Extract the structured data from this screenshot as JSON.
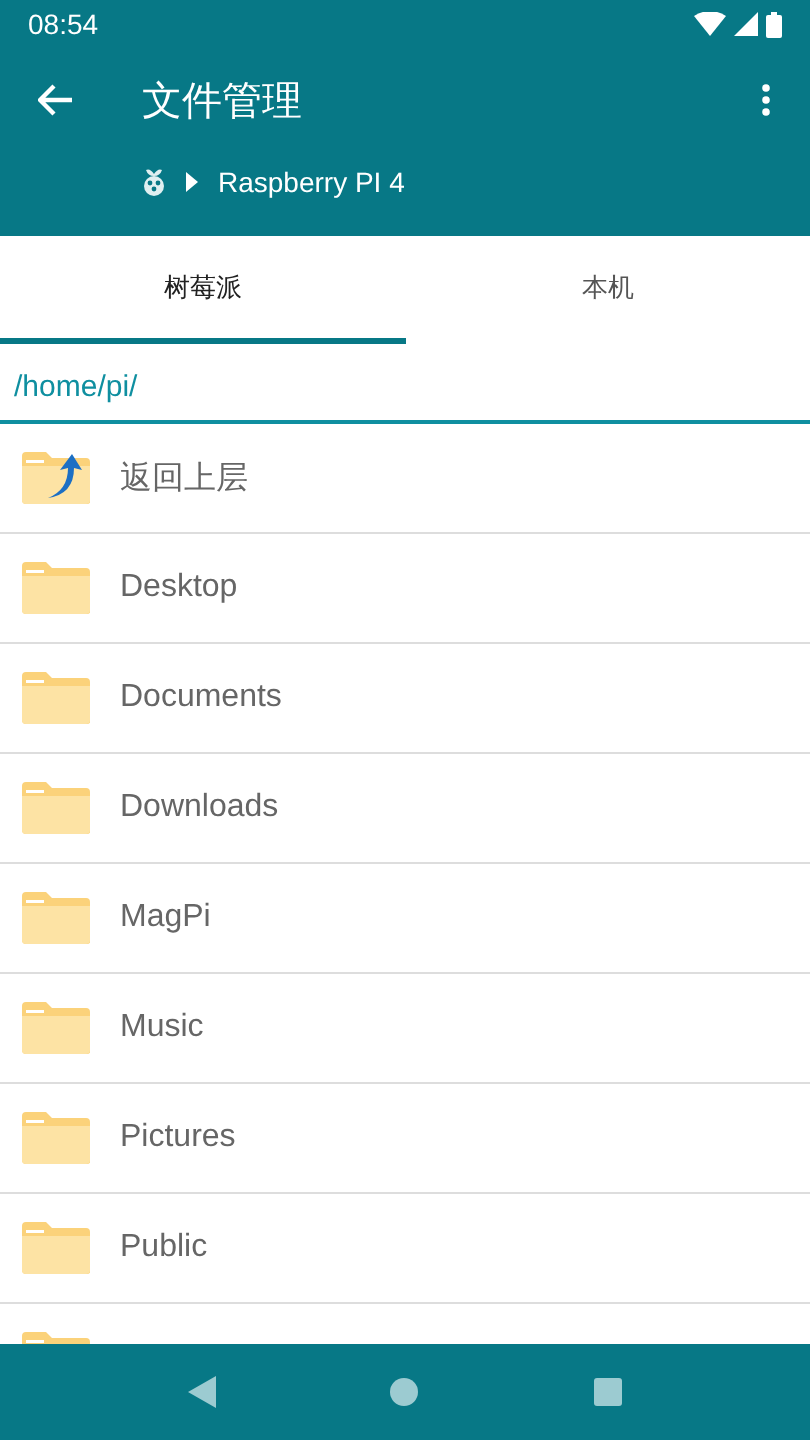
{
  "status_bar": {
    "time": "08:54"
  },
  "toolbar": {
    "title": "文件管理",
    "device": "Raspberry PI 4"
  },
  "tabs": [
    {
      "label": "树莓派",
      "selected": true
    },
    {
      "label": "本机",
      "selected": false
    }
  ],
  "path": "/home/pi/",
  "files": [
    {
      "kind": "up",
      "name": "返回上层"
    },
    {
      "kind": "folder",
      "name": "Desktop"
    },
    {
      "kind": "folder",
      "name": "Documents"
    },
    {
      "kind": "folder",
      "name": "Downloads"
    },
    {
      "kind": "folder",
      "name": "MagPi"
    },
    {
      "kind": "folder",
      "name": "Music"
    },
    {
      "kind": "folder",
      "name": "Pictures"
    },
    {
      "kind": "folder",
      "name": "Public"
    },
    {
      "kind": "folder"
    }
  ]
}
